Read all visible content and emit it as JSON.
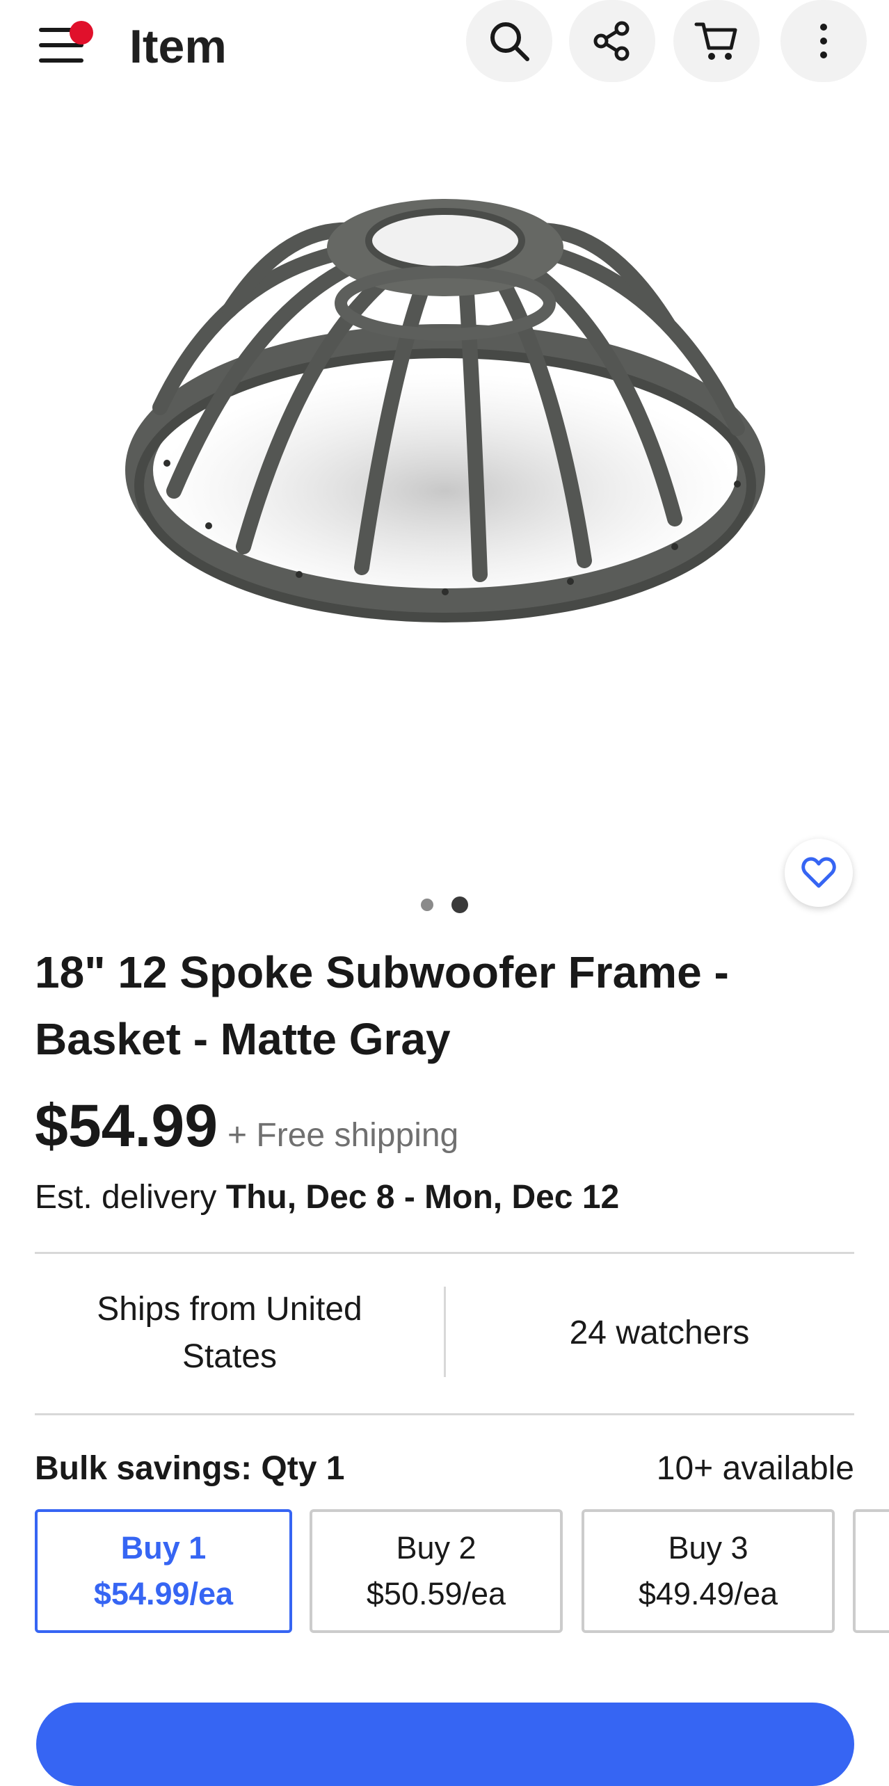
{
  "header": {
    "title": "Item",
    "icons": [
      "menu-icon",
      "search-icon",
      "share-icon",
      "cart-icon",
      "more-icon"
    ]
  },
  "gallery": {
    "image_count": 2,
    "active_index": 2,
    "image_description": "18 inch 12 spoke subwoofer basket frame, matte gray"
  },
  "item": {
    "title_line1": "18\" 12 Spoke Subwoofer Frame -",
    "title_line2": "Basket  - Matte Gray",
    "price": "$54.99",
    "shipping": "+ Free shipping",
    "delivery_prefix": "Est. delivery",
    "delivery_range": "Thu, Dec 8 - Mon, Dec 12"
  },
  "info": {
    "ships_from_line1": "Ships from United",
    "ships_from_line2": "States",
    "watchers": "24 watchers"
  },
  "bulk": {
    "label": "Bulk savings: Qty 1",
    "available": "10+ available",
    "options": [
      {
        "title": "Buy 1",
        "price": "$54.99/ea",
        "selected": true
      },
      {
        "title": "Buy 2",
        "price": "$50.59/ea",
        "selected": false
      },
      {
        "title": "Buy 3",
        "price": "$49.49/ea",
        "selected": false
      }
    ]
  },
  "colors": {
    "accent": "#3665f3",
    "notification": "#e0102b",
    "text": "#191919",
    "muted": "#707070",
    "divider": "#d8d8d8"
  }
}
